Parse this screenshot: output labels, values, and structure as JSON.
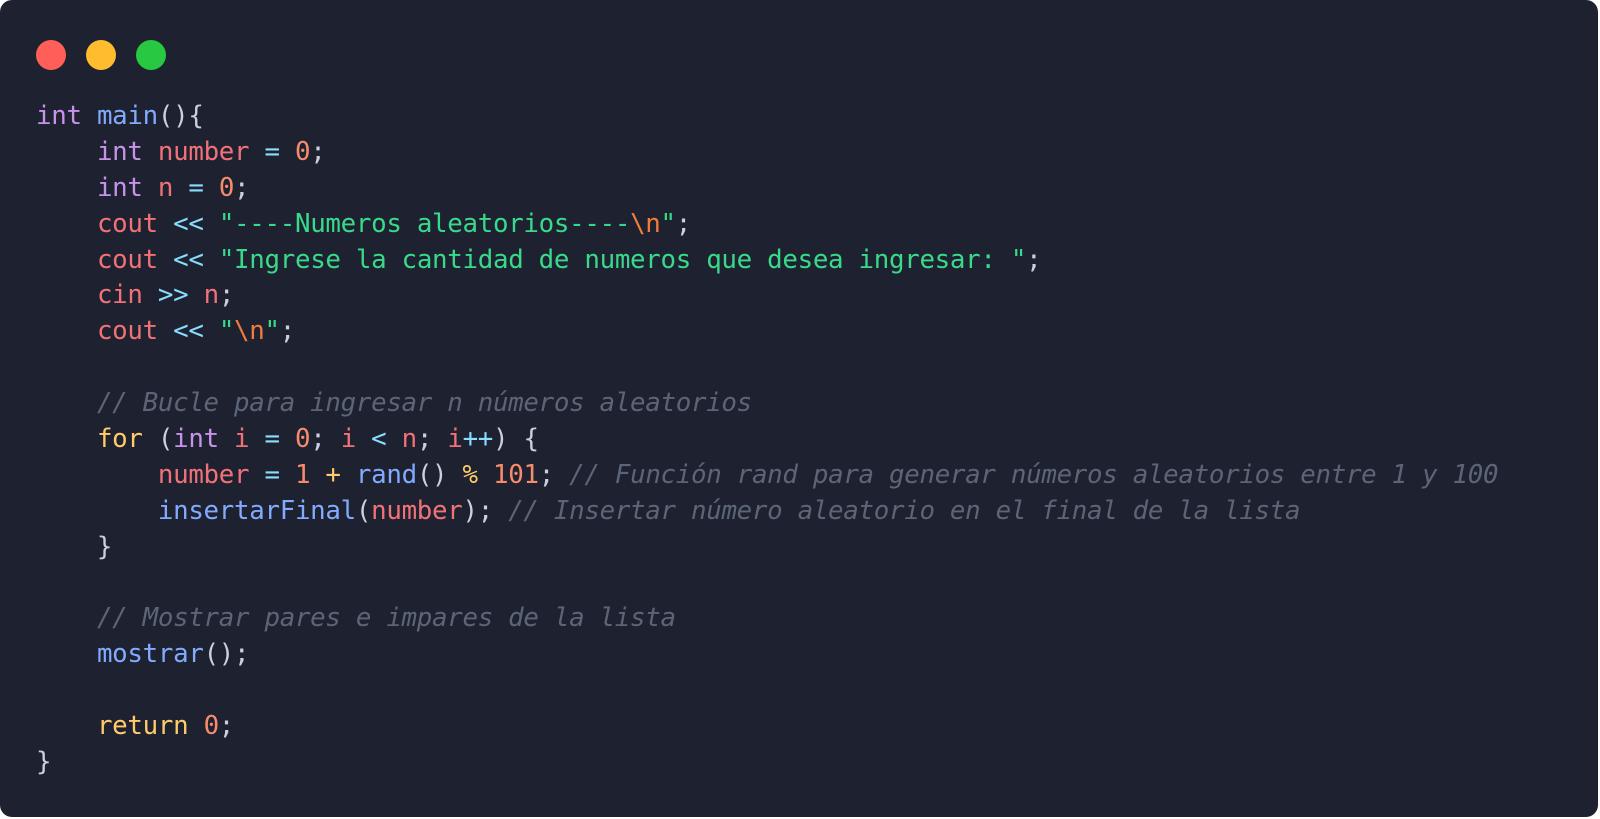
{
  "window": {
    "controls": [
      {
        "name": "close",
        "color": "#ff5f57"
      },
      {
        "name": "minimize",
        "color": "#febc2e"
      },
      {
        "name": "maximize",
        "color": "#28c840"
      }
    ]
  },
  "theme": {
    "background": "#1e2230",
    "keyword": "#c792ea",
    "function": "#82aaff",
    "variable": "#f07178",
    "number": "#f78c6c",
    "operator": "#89ddff",
    "string": "#39d98a",
    "escape": "#f07c3c",
    "control": "#ffcb6b",
    "comment": "#5c6577",
    "punctuation": "#c9d1e0"
  },
  "code": {
    "language": "cpp",
    "lines": [
      [
        {
          "t": "int",
          "k": "keyword"
        },
        {
          "t": " ",
          "k": "punct"
        },
        {
          "t": "main",
          "k": "function"
        },
        {
          "t": "(){",
          "k": "punct"
        }
      ],
      [
        {
          "t": "    ",
          "k": "punct"
        },
        {
          "t": "int",
          "k": "keyword"
        },
        {
          "t": " ",
          "k": "punct"
        },
        {
          "t": "number",
          "k": "variable"
        },
        {
          "t": " ",
          "k": "punct"
        },
        {
          "t": "=",
          "k": "operator"
        },
        {
          "t": " ",
          "k": "punct"
        },
        {
          "t": "0",
          "k": "number"
        },
        {
          "t": ";",
          "k": "punct"
        }
      ],
      [
        {
          "t": "    ",
          "k": "punct"
        },
        {
          "t": "int",
          "k": "keyword"
        },
        {
          "t": " ",
          "k": "punct"
        },
        {
          "t": "n",
          "k": "variable"
        },
        {
          "t": " ",
          "k": "punct"
        },
        {
          "t": "=",
          "k": "operator"
        },
        {
          "t": " ",
          "k": "punct"
        },
        {
          "t": "0",
          "k": "number"
        },
        {
          "t": ";",
          "k": "punct"
        }
      ],
      [
        {
          "t": "    ",
          "k": "punct"
        },
        {
          "t": "cout",
          "k": "variable"
        },
        {
          "t": " ",
          "k": "punct"
        },
        {
          "t": "<<",
          "k": "operator"
        },
        {
          "t": " ",
          "k": "punct"
        },
        {
          "t": "\"----Numeros aleatorios----",
          "k": "string"
        },
        {
          "t": "\\n",
          "k": "escape"
        },
        {
          "t": "\"",
          "k": "string"
        },
        {
          "t": ";",
          "k": "punct"
        }
      ],
      [
        {
          "t": "    ",
          "k": "punct"
        },
        {
          "t": "cout",
          "k": "variable"
        },
        {
          "t": " ",
          "k": "punct"
        },
        {
          "t": "<<",
          "k": "operator"
        },
        {
          "t": " ",
          "k": "punct"
        },
        {
          "t": "\"Ingrese la cantidad de numeros que desea ingresar: \"",
          "k": "string"
        },
        {
          "t": ";",
          "k": "punct"
        }
      ],
      [
        {
          "t": "    ",
          "k": "punct"
        },
        {
          "t": "cin",
          "k": "variable"
        },
        {
          "t": " ",
          "k": "punct"
        },
        {
          "t": ">>",
          "k": "operator"
        },
        {
          "t": " ",
          "k": "punct"
        },
        {
          "t": "n",
          "k": "variable"
        },
        {
          "t": ";",
          "k": "punct"
        }
      ],
      [
        {
          "t": "    ",
          "k": "punct"
        },
        {
          "t": "cout",
          "k": "variable"
        },
        {
          "t": " ",
          "k": "punct"
        },
        {
          "t": "<<",
          "k": "operator"
        },
        {
          "t": " ",
          "k": "punct"
        },
        {
          "t": "\"",
          "k": "string"
        },
        {
          "t": "\\n",
          "k": "escape"
        },
        {
          "t": "\"",
          "k": "string"
        },
        {
          "t": ";",
          "k": "punct"
        }
      ],
      [],
      [
        {
          "t": "    ",
          "k": "punct"
        },
        {
          "t": "// Bucle para ingresar n números aleatorios",
          "k": "comment"
        }
      ],
      [
        {
          "t": "    ",
          "k": "punct"
        },
        {
          "t": "for",
          "k": "control"
        },
        {
          "t": " (",
          "k": "punct"
        },
        {
          "t": "int",
          "k": "keyword"
        },
        {
          "t": " ",
          "k": "punct"
        },
        {
          "t": "i",
          "k": "variable"
        },
        {
          "t": " ",
          "k": "punct"
        },
        {
          "t": "=",
          "k": "operator"
        },
        {
          "t": " ",
          "k": "punct"
        },
        {
          "t": "0",
          "k": "number"
        },
        {
          "t": "; ",
          "k": "punct"
        },
        {
          "t": "i",
          "k": "variable"
        },
        {
          "t": " ",
          "k": "punct"
        },
        {
          "t": "<",
          "k": "operator"
        },
        {
          "t": " ",
          "k": "punct"
        },
        {
          "t": "n",
          "k": "variable"
        },
        {
          "t": "; ",
          "k": "punct"
        },
        {
          "t": "i",
          "k": "variable"
        },
        {
          "t": "++",
          "k": "operator"
        },
        {
          "t": ") {",
          "k": "punct"
        }
      ],
      [
        {
          "t": "        ",
          "k": "punct"
        },
        {
          "t": "number",
          "k": "variable"
        },
        {
          "t": " ",
          "k": "punct"
        },
        {
          "t": "=",
          "k": "operator"
        },
        {
          "t": " ",
          "k": "punct"
        },
        {
          "t": "1",
          "k": "number"
        },
        {
          "t": " ",
          "k": "punct"
        },
        {
          "t": "+",
          "k": "control"
        },
        {
          "t": " ",
          "k": "punct"
        },
        {
          "t": "rand",
          "k": "function"
        },
        {
          "t": "() ",
          "k": "punct"
        },
        {
          "t": "%",
          "k": "control"
        },
        {
          "t": " ",
          "k": "punct"
        },
        {
          "t": "101",
          "k": "number"
        },
        {
          "t": "; ",
          "k": "punct"
        },
        {
          "t": "// Función rand para generar números aleatorios entre 1 y 100",
          "k": "comment"
        }
      ],
      [
        {
          "t": "        ",
          "k": "punct"
        },
        {
          "t": "insertarFinal",
          "k": "function"
        },
        {
          "t": "(",
          "k": "punct"
        },
        {
          "t": "number",
          "k": "variable"
        },
        {
          "t": "); ",
          "k": "punct"
        },
        {
          "t": "// Insertar número aleatorio en el final de la lista",
          "k": "comment"
        }
      ],
      [
        {
          "t": "    }",
          "k": "punct"
        }
      ],
      [],
      [
        {
          "t": "    ",
          "k": "punct"
        },
        {
          "t": "// Mostrar pares e impares de la lista",
          "k": "comment"
        }
      ],
      [
        {
          "t": "    ",
          "k": "punct"
        },
        {
          "t": "mostrar",
          "k": "function"
        },
        {
          "t": "();",
          "k": "punct"
        }
      ],
      [],
      [
        {
          "t": "    ",
          "k": "punct"
        },
        {
          "t": "return",
          "k": "control"
        },
        {
          "t": " ",
          "k": "punct"
        },
        {
          "t": "0",
          "k": "number"
        },
        {
          "t": ";",
          "k": "punct"
        }
      ],
      [
        {
          "t": "}",
          "k": "punct"
        }
      ]
    ]
  }
}
